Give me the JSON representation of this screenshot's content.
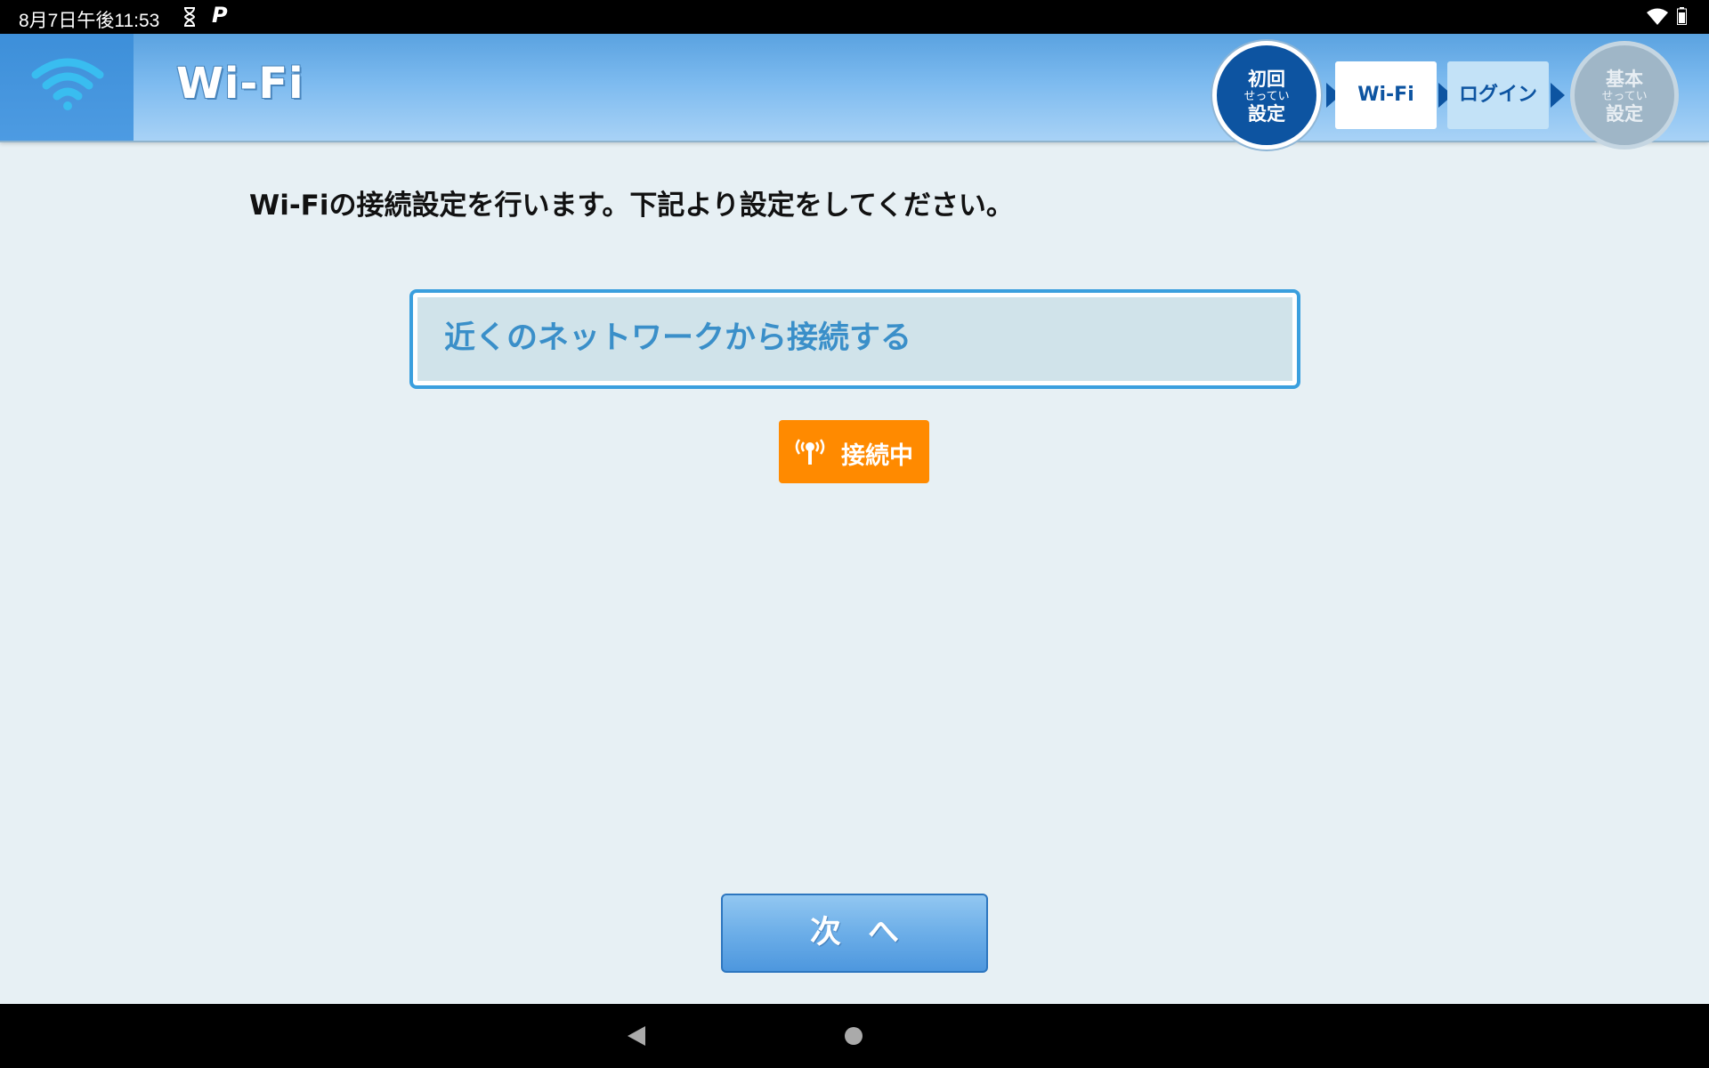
{
  "status_bar": {
    "time": "8月7日午後11:53",
    "icons": [
      "hourglass-icon",
      "p-icon",
      "wifi-icon",
      "battery-icon"
    ]
  },
  "header": {
    "title": "Wi-Fi",
    "icon": "wifi-icon"
  },
  "steps": [
    {
      "label": "初回",
      "ruby": "せってい",
      "label2": "設定",
      "state": "done"
    },
    {
      "label": "Wi-Fi",
      "state": "current"
    },
    {
      "label": "ログイン",
      "state": "upcoming"
    },
    {
      "label": "基本",
      "ruby": "せってい",
      "label2": "設定",
      "state": "inactive"
    }
  ],
  "main": {
    "instruction": "Wi-Fiの接続設定を行います。下記より設定をしてください。",
    "nearby_network_button": "近くのネットワークから接続する",
    "connection_status": "接続中",
    "next_button": "次へ"
  },
  "colors": {
    "accent_blue": "#0d54a1",
    "status_orange": "#ff8a00",
    "button_blue": "#6caee8",
    "background": "#e7f0f4"
  }
}
